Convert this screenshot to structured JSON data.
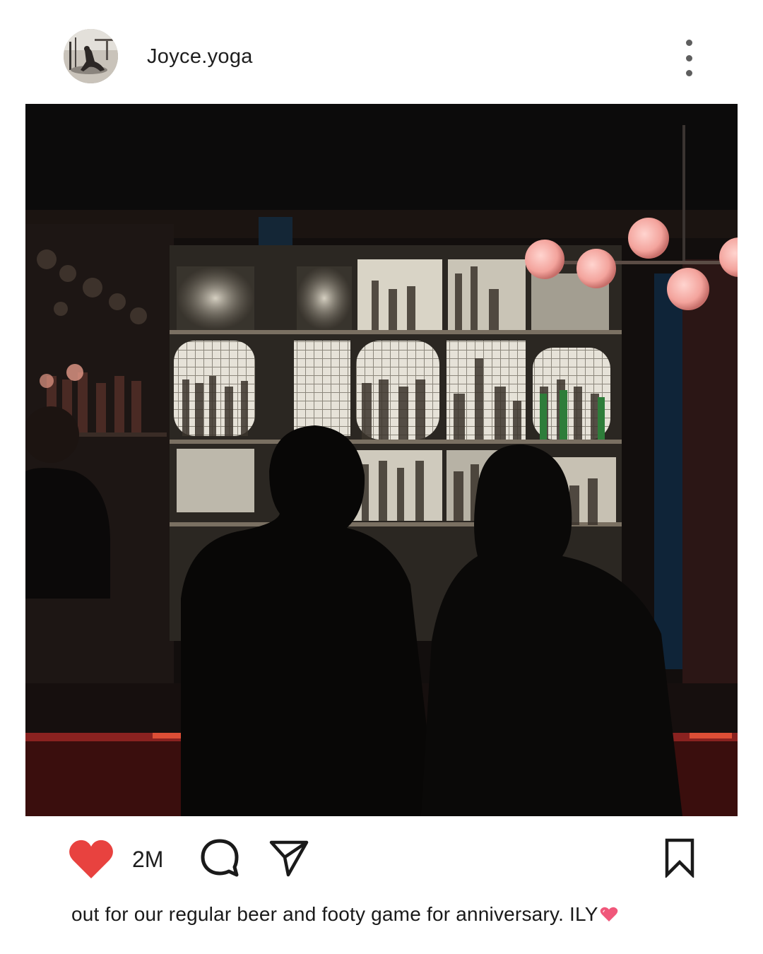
{
  "post": {
    "username": "Joyce.yoga",
    "likes_count": "2M",
    "caption": "out for our regular beer and footy game for anniversary. ILY",
    "caption_emoji": "heart-emoji"
  },
  "icons": {
    "menu": "more-vertical-icon",
    "like": "heart-icon",
    "comment": "comment-bubble-icon",
    "share": "paper-plane-icon",
    "save": "bookmark-icon"
  },
  "colors": {
    "like": "#e8423f",
    "icon_stroke": "#1a1a1a",
    "menu_dots": "#5e5e5e",
    "emoji_heart": "#f0577a"
  }
}
